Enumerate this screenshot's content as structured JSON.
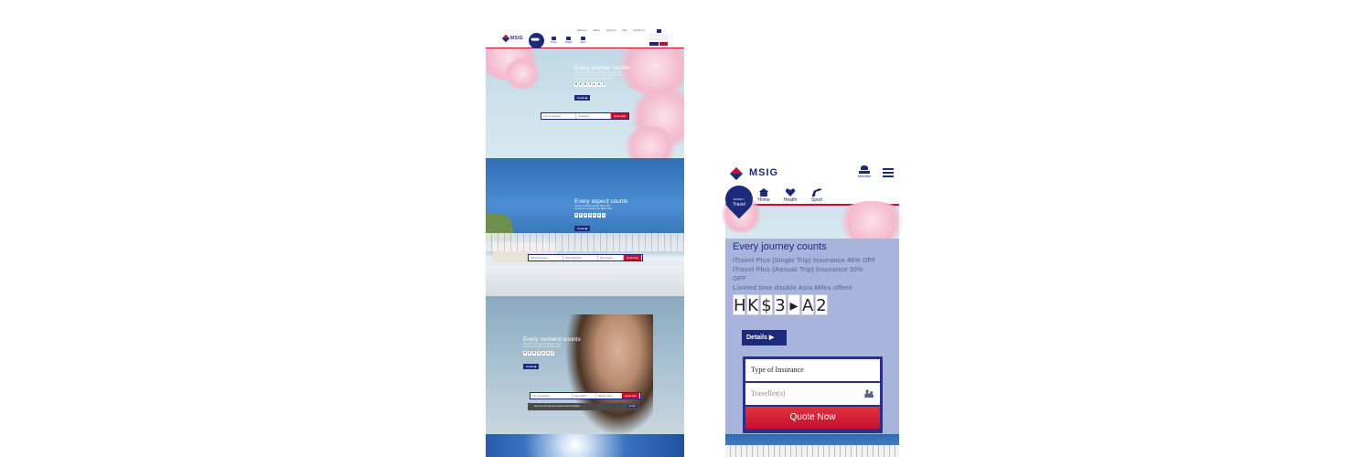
{
  "desktop": {
    "logo": "MSIG",
    "top_links": [
      "Welcome",
      "Claims",
      "About Us",
      "FAQ",
      "Contact Us"
    ],
    "nav_tabs": [
      {
        "label": "Travel",
        "icon": "plane-icon"
      },
      {
        "label": "Home",
        "icon": "home-icon"
      },
      {
        "label": "Health",
        "icon": "heart-icon"
      },
      {
        "label": "Sport",
        "icon": "golf-icon"
      }
    ],
    "hero1": {
      "title": "Every journey counts",
      "lines": [
        "iTravel Plus (Single Trip) Insurance 45% OFF",
        "iTravel Plus (Annual Trip) Insurance 30% OFF",
        "Limited time double Asia Miles offer"
      ],
      "price": [
        "H",
        "K",
        "$",
        "3",
        "▸",
        "A",
        "2"
      ],
      "details": "Details ▶",
      "quote_fields": [
        "Type of Insurance",
        "Traveller(s)"
      ],
      "quote_button": "Quote Now"
    },
    "hero2": {
      "title": "Every aspect counts",
      "lines": [
        "Home Insurance Series 30% OFF",
        "Limited time double Asia Miles offer"
      ],
      "price": [
        "H",
        "K",
        "$",
        "3",
        "▸",
        "A",
        "2"
      ],
      "details": "Details ▶",
      "quote_fields": [
        "Type of Insurance",
        "Home Protection",
        "Sum Insured"
      ],
      "quote_button": "Quote Now"
    },
    "hero3": {
      "title": "Every moment counts",
      "lines": [
        "30% OFF on Health Protection Plan",
        "Limited time double Asia Miles offer"
      ],
      "price": [
        "H",
        "K",
        "$",
        "3",
        "▸",
        "A",
        "2"
      ],
      "details": "Details ▶",
      "quote_fields": [
        "Type of Insurance",
        "Date of Birth",
        "Effective Date"
      ],
      "quote_button": "Quote Now",
      "strip_text": "Now you can also get rewarded with Asia Miles",
      "strip_button": "Details"
    }
  },
  "mobile": {
    "logo": "MSIG",
    "user_label": "Member",
    "nav_tabs": [
      {
        "label": "Travel",
        "icon": "plane-icon"
      },
      {
        "label": "Home",
        "icon": "home-icon"
      },
      {
        "label": "Health",
        "icon": "heart-icon"
      },
      {
        "label": "Sport",
        "icon": "golf-icon"
      }
    ],
    "hero_title": "Every journey counts",
    "offers": [
      "iTravel Plus (Single Trip) Insurance 45% OFF",
      "iTravel Plus (Annual Trip) Insurance 30%",
      "OFF",
      "Limited time double Asia Miles offer#"
    ],
    "price": [
      "H",
      "K",
      "$",
      "3",
      "▸",
      "A",
      "2"
    ],
    "details": "Details ▶",
    "form": {
      "insurance_type": "Type of Insurance",
      "travellers_placeholder": "Traveller(s)",
      "quote_button": "Quote Now"
    }
  },
  "colors": {
    "brand_navy": "#1b2a7a",
    "brand_red": "#c8102e",
    "panel_lavender": "#a9b4dc"
  }
}
